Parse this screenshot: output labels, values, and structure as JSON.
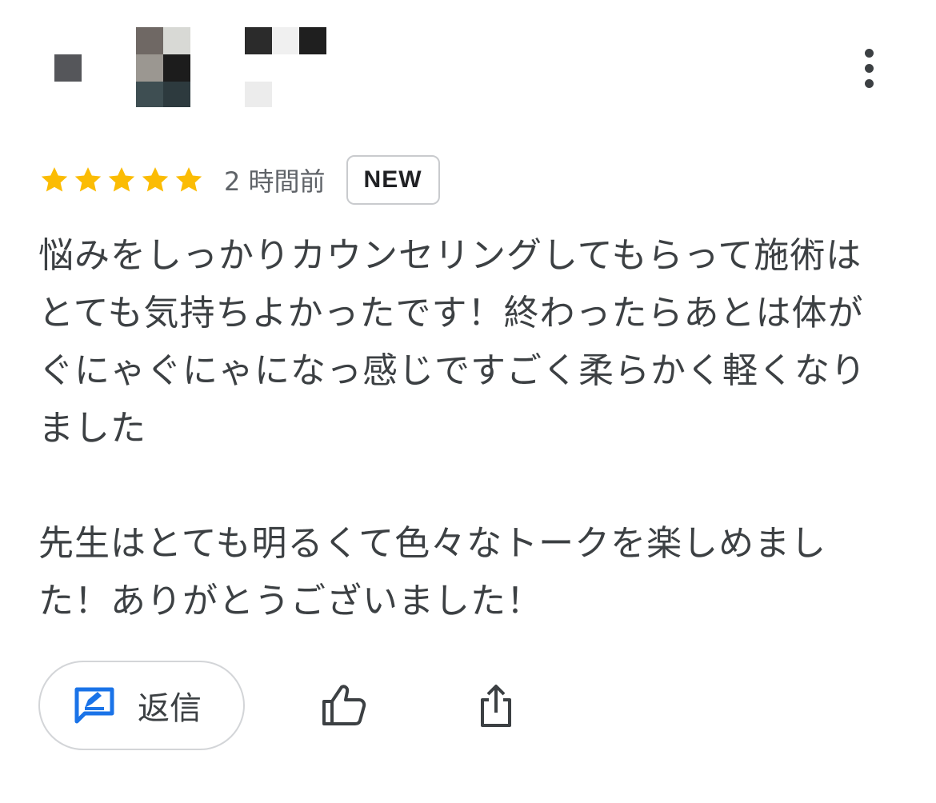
{
  "header": {
    "avatar_icon": "pixelated-avatar",
    "reviewer_name_icon": "pixelated-name",
    "menu_icon": "more-vertical-icon"
  },
  "review": {
    "rating": 5,
    "rating_max": 5,
    "star_color": "#fbbc04",
    "time_ago": "2 時間前",
    "badge": "NEW",
    "paragraphs": [
      "悩みをしっかりカウンセリングしてもらって施術はとても気持ちよかったです！終わったらあとは体がぐにゃぐにゃになっ感じですごく柔らかく軽くなりました",
      "先生はとても明るくて色々なトークを楽しめました！ありがとうございました！"
    ]
  },
  "actions": {
    "reply_label": "返信",
    "reply_icon": "reply-icon",
    "reply_icon_color": "#1a73e8",
    "like_icon": "thumbs-up-icon",
    "share_icon": "share-icon"
  }
}
